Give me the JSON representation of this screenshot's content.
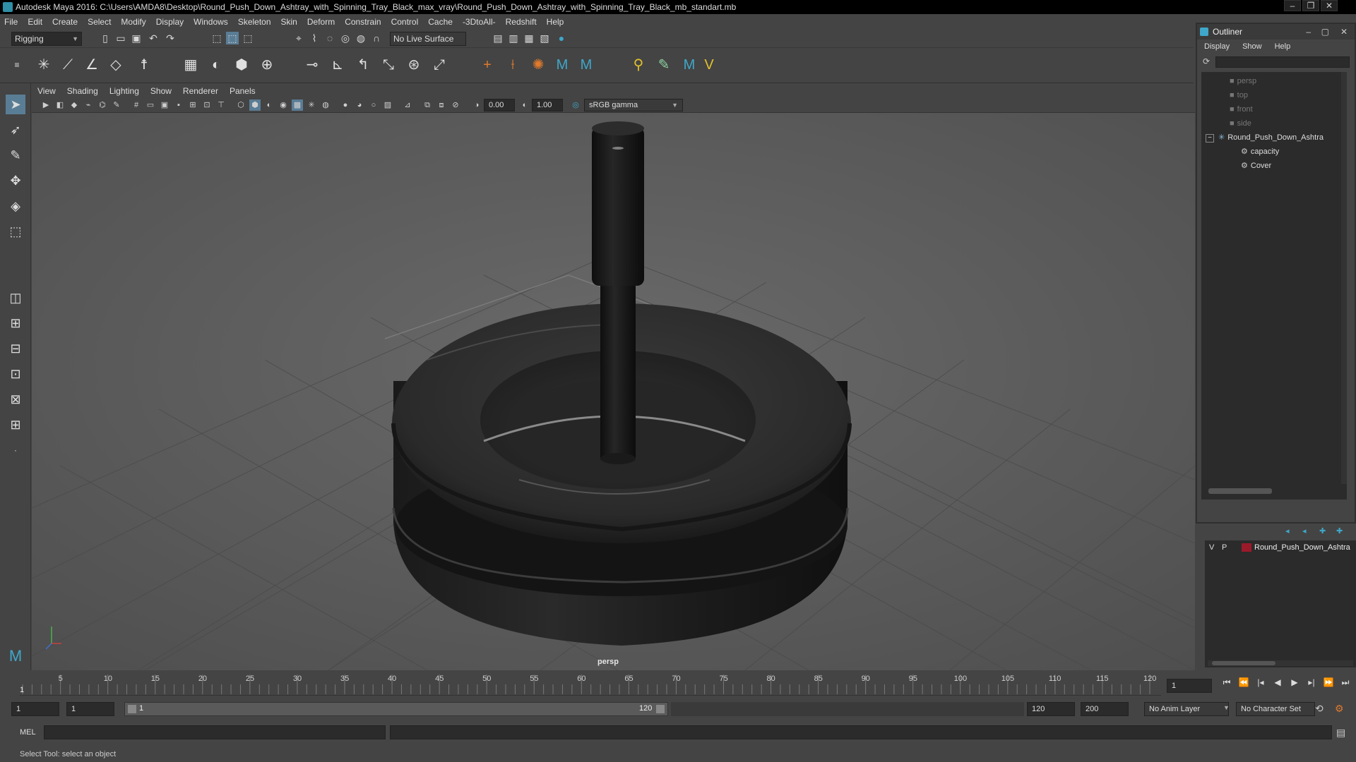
{
  "window": {
    "title": "Autodesk Maya 2016: C:\\Users\\AMDA8\\Desktop\\Round_Push_Down_Ashtray_with_Spinning_Tray_Black_max_vray\\Round_Push_Down_Ashtray_with_Spinning_Tray_Black_mb_standart.mb"
  },
  "menubar": [
    "File",
    "Edit",
    "Create",
    "Select",
    "Modify",
    "Display",
    "Windows",
    "Skeleton",
    "Skin",
    "Deform",
    "Constrain",
    "Control",
    "Cache",
    "-3DtoAll-",
    "Redshift",
    "Help"
  ],
  "toolbar": {
    "mode_dropdown": "Rigging",
    "live_surface": "No Live Surface"
  },
  "panel_menu": [
    "View",
    "Shading",
    "Lighting",
    "Show",
    "Renderer",
    "Panels"
  ],
  "panel_toolbar": {
    "exposure": "0.00",
    "gamma": "1.00",
    "color_space": "sRGB gamma"
  },
  "viewport": {
    "camera_label": "persp"
  },
  "outliner": {
    "title": "Outliner",
    "menu": [
      "Display",
      "Show",
      "Help"
    ],
    "items": [
      {
        "label": "persp",
        "kind": "camera"
      },
      {
        "label": "top",
        "kind": "camera"
      },
      {
        "label": "front",
        "kind": "camera"
      },
      {
        "label": "side",
        "kind": "camera"
      },
      {
        "label": "Round_Push_Down_Ashtra",
        "kind": "group"
      },
      {
        "label": "capacity",
        "kind": "mesh"
      },
      {
        "label": "Cover",
        "kind": "mesh"
      }
    ]
  },
  "layers": {
    "row": {
      "v": "V",
      "p": "P",
      "name": "Round_Push_Down_Ashtra",
      "color": "#9b1a2a"
    }
  },
  "timeline": {
    "ticks": [
      "5",
      "10",
      "15",
      "20",
      "25",
      "30",
      "35",
      "40",
      "45",
      "50",
      "55",
      "60",
      "65",
      "70",
      "75",
      "80",
      "85",
      "90",
      "95",
      "100",
      "105",
      "110",
      "115",
      "120"
    ],
    "current_frame_marker": "1",
    "current_frame_field": "1"
  },
  "range": {
    "start": "1",
    "playback_start": "1",
    "slider_start_label": "1",
    "slider_end_label": "120",
    "playback_end": "120",
    "end": "200",
    "anim_layer": "No Anim Layer",
    "character_set": "No Character Set"
  },
  "command": {
    "label": "MEL"
  },
  "help_line": "Select Tool: select an object",
  "colors": {
    "accent": "#3fa7c9",
    "layer_color": "#9b1a2a"
  }
}
